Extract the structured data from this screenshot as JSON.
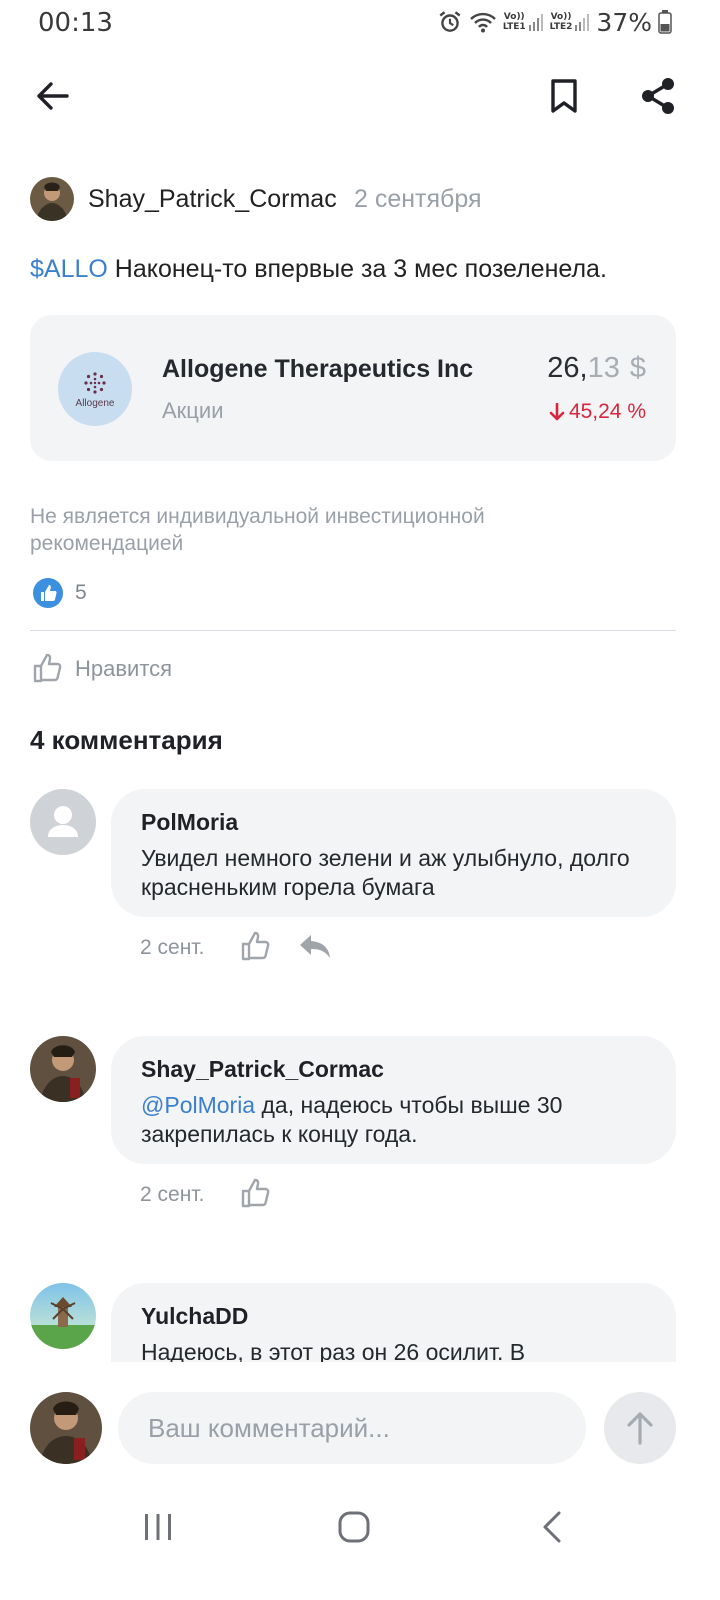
{
  "status_bar": {
    "time": "00:13",
    "sim1": "LTE1",
    "sim2": "LTE2",
    "vo1": "Vo))",
    "vo2": "Vo))",
    "battery": "37%",
    "icons": [
      "alarm-icon",
      "wifi-icon",
      "signal-icon",
      "battery-icon"
    ]
  },
  "top_bar": {
    "icons": [
      "back-arrow-icon",
      "bookmark-icon",
      "share-icon"
    ]
  },
  "post": {
    "author": "Shay_Patrick_Cormac",
    "date": "2 сентября",
    "ticker": "$ALLO",
    "text": " Наконец-то впервые за 3 мес позеленела.",
    "instrument": {
      "logo_text": "Allogene",
      "name": "Allogene Therapeutics Inc",
      "type": "Акции",
      "price_int": "26,",
      "price_frac": "13",
      "currency": "$",
      "change": "45,24 %",
      "change_color": "#d7263d"
    },
    "disclaimer": "Не является индивидуальной инвестиционной рекомендацией",
    "likes_count": "5",
    "like_label": "Нравится"
  },
  "comments_header": "4 комментария",
  "comments": [
    {
      "author": "PolMoria",
      "mention": "",
      "text": "Увидел немного зелени и аж улыбнуло, долго красненьким горела бумага",
      "date": "2 сент."
    },
    {
      "author": "Shay_Patrick_Cormac",
      "mention": "@PolMoria",
      "text": " да, надеюсь чтобы выше 30 закрепилась к концу года.",
      "date": "2 сент."
    },
    {
      "author": "YulchaDD",
      "mention": "",
      "text": "Надеюсь, в этот раз он 26 осилит. В",
      "date": ""
    }
  ],
  "composer": {
    "placeholder": "Ваш комментарий..."
  },
  "colors": {
    "accent": "#3b7fcf",
    "negative": "#d7263d",
    "card_bg": "#f2f4f6"
  }
}
